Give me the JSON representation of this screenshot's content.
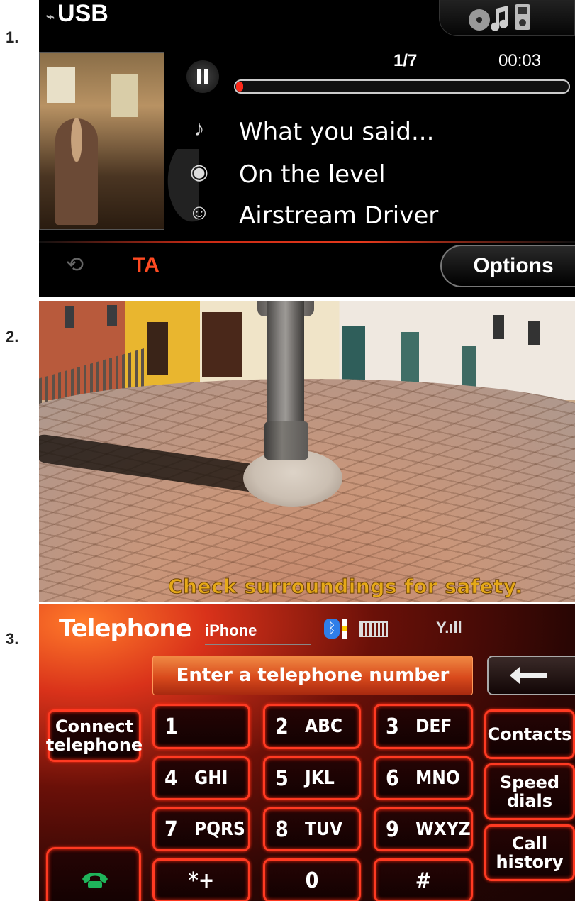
{
  "labels": {
    "screen1": "1.",
    "screen2": "2.",
    "screen3": "3."
  },
  "usb": {
    "source_title": "USB",
    "media_source_icon": "disc-note-player-icon",
    "track_count": "1/7",
    "elapsed_time": "00:03",
    "progress_fraction": 0.01,
    "song": "What you said...",
    "album": "On the level",
    "artist": "Airstream Driver",
    "repeat_icon": "repeat-icon",
    "ta_label": "TA",
    "options_label": "Options",
    "accent_color": "#ff4a22"
  },
  "camera": {
    "warning_text": "Check surroundings for safety.",
    "warning_color": "#e6a918"
  },
  "phone": {
    "title": "Telephone",
    "device_name": "iPhone",
    "status_icons": [
      "bluetooth-icon",
      "battery-icon",
      "signal-icon"
    ],
    "signal_text": "Y.ıll",
    "number_placeholder": "Enter a telephone number",
    "connect_label": "Connect\ntelephone",
    "contacts_label": "Contacts",
    "speed_dials_label": "Speed\ndials",
    "call_history_label": "Call\nhistory",
    "keys": [
      {
        "digit": "1",
        "letters": ""
      },
      {
        "digit": "2",
        "letters": "ABC"
      },
      {
        "digit": "3",
        "letters": "DEF"
      },
      {
        "digit": "4",
        "letters": "GHI"
      },
      {
        "digit": "5",
        "letters": "JKL"
      },
      {
        "digit": "6",
        "letters": "MNO"
      },
      {
        "digit": "7",
        "letters": "PQRS"
      },
      {
        "digit": "8",
        "letters": "TUV"
      },
      {
        "digit": "9",
        "letters": "WXYZ"
      },
      {
        "digit": "*+",
        "letters": ""
      },
      {
        "digit": "0",
        "letters": ""
      },
      {
        "digit": "#",
        "letters": ""
      }
    ],
    "key_border_color": "#ff3a22",
    "call_icon_color": "#1fb35a"
  }
}
